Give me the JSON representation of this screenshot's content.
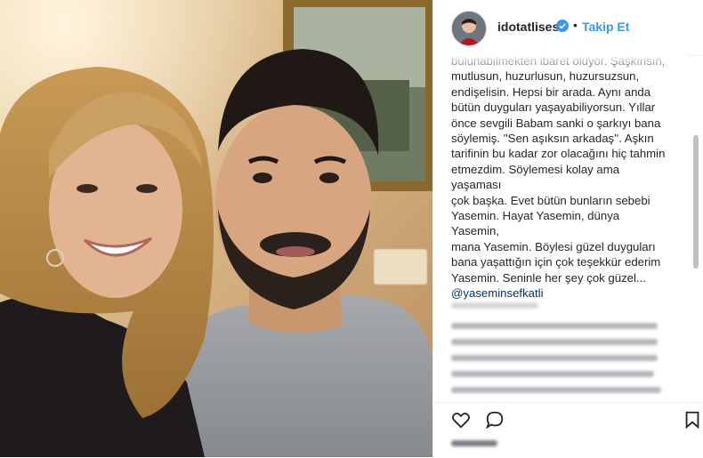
{
  "post": {
    "username": "idotatlises",
    "dot": "•",
    "follow_label": "Takip Et",
    "caption": "bulunabilmekten ibaret oluyor. Şaşkınsın,\nmutlusun, huzurlusun, huzursuzsun,\nendişelisin. Hepsi bir arada. Aynı anda\nbütün duyguları yaşayabiliyorsun. Yıllar\nönce sevgili Babam sanki o şarkıyı bana\nsöylemiş. ''Sen aşıksın arkadaş''. Aşkın\ntarifinin bu kadar zor olacağını hiç tahmin\netmezdim. Söylemesi kolay ama yaşaması\nçok başka. Evet bütün bunların sebebi\nYasemin. Hayat Yasemin, dünya Yasemin,\nmana Yasemin. Böylesi güzel duyguları\nbana yaşattığın için çok teşekkür ederim\nYasemin. Seninle her şey çok güzel...",
    "mention": "@yaseminsefkatli"
  },
  "icons": {
    "verified": "verified-badge-icon",
    "like": "heart-icon",
    "comment": "comment-bubble-icon",
    "save": "bookmark-icon"
  },
  "colors": {
    "follow": "#3897f0",
    "verified": "#3897f0",
    "mention": "#003569",
    "text": "#262626"
  }
}
